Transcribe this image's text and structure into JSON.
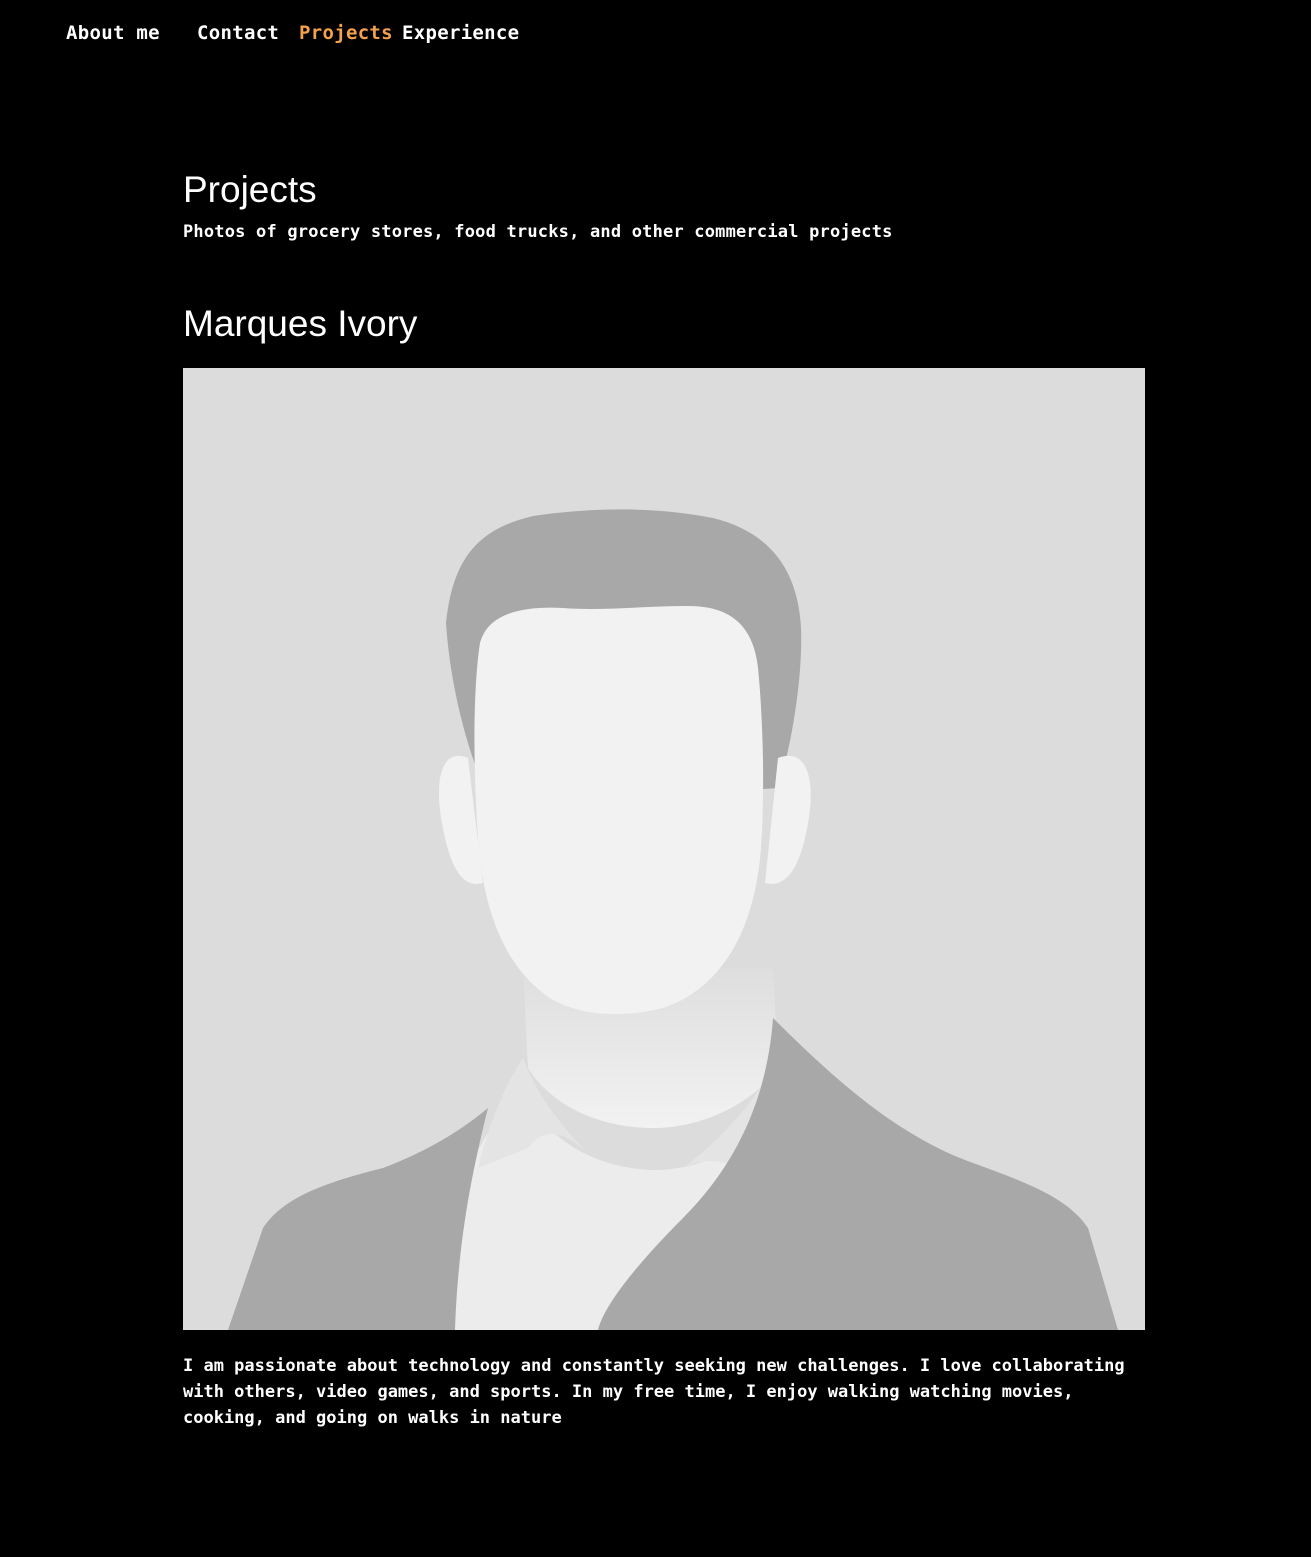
{
  "nav": {
    "items": [
      {
        "label": "About me",
        "active": false
      },
      {
        "label": "Contact",
        "active": false
      },
      {
        "label": "Projects",
        "active": true
      },
      {
        "label": "Experience",
        "active": false
      }
    ]
  },
  "colors": {
    "background": "#000000",
    "text": "#ffffff",
    "accent": "#f4a14c",
    "photo_background": "#dcdcdc"
  },
  "page": {
    "title": "Projects",
    "subtitle": "Photos of grocery stores, food trucks, and other commercial projects"
  },
  "profile": {
    "name": "Marques Ivory",
    "photo_icon": "default-avatar-silhouette",
    "bio": "I am passionate about technology and constantly seeking new challenges. I love collaborating with others, video games, and sports. In my free time, I enjoy walking watching movies, cooking, and going on walks in nature"
  }
}
